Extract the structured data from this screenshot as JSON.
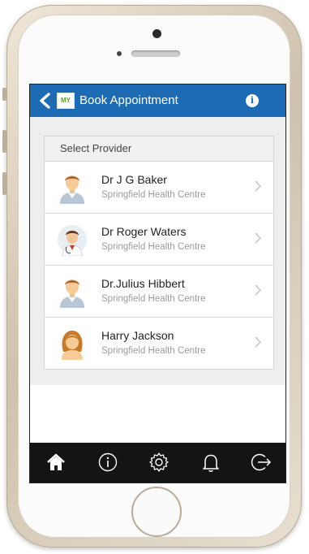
{
  "header": {
    "title": "Book Appointment",
    "logo_text": "MY",
    "info_label": "i",
    "color": "#1d6cb3"
  },
  "providers": {
    "heading": "Select Provider",
    "items": [
      {
        "name": "Dr J G Baker",
        "clinic": "Springfield Health Centre",
        "avatar": "male-doctor-avatar"
      },
      {
        "name": "Dr Roger Waters",
        "clinic": "Springfield Health Centre",
        "avatar": "doctor-stethoscope-avatar"
      },
      {
        "name": "Dr.Julius Hibbert",
        "clinic": "Springfield Health Centre",
        "avatar": "male-doctor-avatar"
      },
      {
        "name": "Harry Jackson",
        "clinic": "Springfield Health Centre",
        "avatar": "female-avatar"
      }
    ]
  },
  "tabbar": {
    "icons": [
      "home-icon",
      "info-icon",
      "settings-icon",
      "bell-icon",
      "logout-icon"
    ]
  }
}
